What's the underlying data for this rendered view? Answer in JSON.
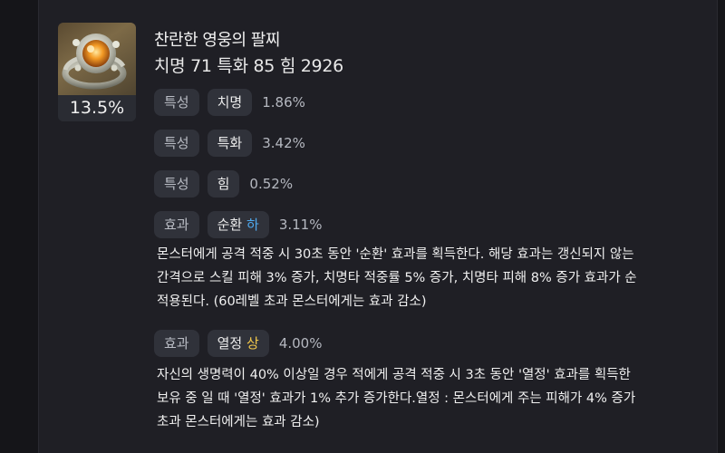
{
  "item": {
    "quality": "13.5%",
    "title": "찬란한 영웅의 팔찌",
    "stats_line": "치명 71   특화 85   힘 2926"
  },
  "rows": [
    {
      "type": "특성",
      "name": "치명",
      "value": "1.86%"
    },
    {
      "type": "특성",
      "name": "특화",
      "value": "3.42%"
    },
    {
      "type": "특성",
      "name": "힘",
      "value": "0.52%"
    },
    {
      "type": "효과",
      "name": "순환",
      "grade": "하",
      "grade_color": "#4faaf0",
      "value": "3.11%"
    },
    {
      "type": "효과",
      "name": "열정",
      "grade": "상",
      "grade_color": "#f2c84b",
      "value": "4.00%"
    }
  ],
  "effects": {
    "cycle_desc": [
      "몬스터에게 공격 적중 시 30초 동안 '순환' 효과를 획득한다. 해당 효과는 갱신되지 않는",
      "간격으로 스킬 피해 3% 증가, 치명타 적중률 5% 증가, 치명타 피해 8% 증가 효과가 순",
      "적용된다. (60레벨 초과 몬스터에게는 효과 감소)"
    ],
    "passion_desc": [
      "자신의 생명력이 40% 이상일 경우 적에게 공격 적중 시 3초 동안 '열정' 효과를 획득한",
      "보유 중 일 때 '열정' 효과가 1% 추가 증가한다.열정 : 몬스터에게 주는 피해가 4% 증가",
      "초과 몬스터에게는 효과 감소)"
    ]
  },
  "colors": {
    "background": "#151519",
    "panel": "#1f1f25",
    "chip": "#30323a",
    "accent_tab": "#6b2fae",
    "grade_low": "#4faaf0",
    "grade_high": "#f2c84b"
  }
}
